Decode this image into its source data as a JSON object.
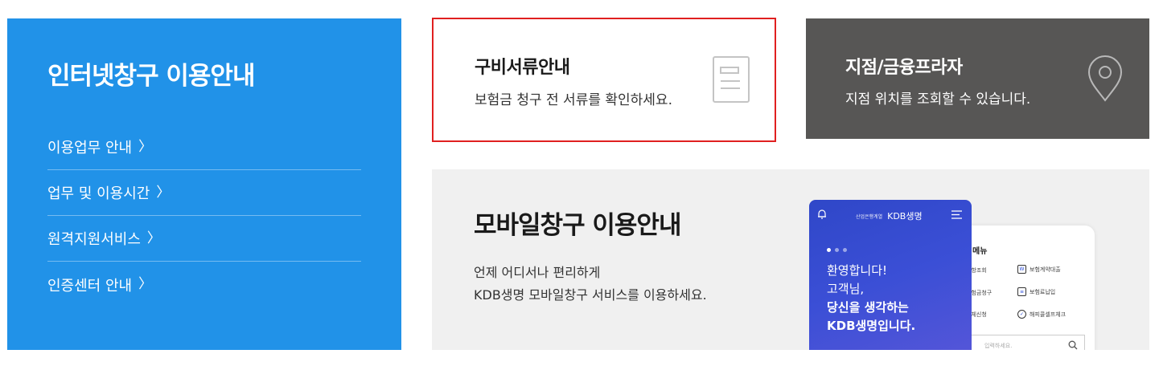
{
  "guide": {
    "title": "인터넷창구 이용안내",
    "menu": [
      {
        "label": "이용업무 안내"
      },
      {
        "label": "업무 및 이용시간"
      },
      {
        "label": "원격지원서비스"
      },
      {
        "label": "인증센터 안내"
      }
    ]
  },
  "docs": {
    "title": "구비서류안내",
    "desc": "보험금 청구 전 서류를 확인하세요.",
    "icon": "document-icon",
    "border_color": "#e02020"
  },
  "branch": {
    "title": "지점/금융프라자",
    "desc": "지점 위치를 조회할 수 있습니다.",
    "icon": "location-pin-icon",
    "bg_color": "#575655"
  },
  "mobile": {
    "title": "모바일창구 이용안내",
    "desc_line1": "언제 어디서나 편리하게",
    "desc_line2": "KDB생명 모바일창구 서비스를 이용하세요.",
    "phone_front": {
      "brand_small": "산업은행계열",
      "brand": "KDB생명",
      "line1": "환영합니다!",
      "line2": "고객님,",
      "line3": "당신을 생각하는",
      "line4": "KDB생명입니다."
    },
    "phone_back": {
      "menu_title": "메뉴",
      "items": [
        {
          "label": "사항조회"
        },
        {
          "label": "보험계약대출"
        },
        {
          "label": "보험금청구"
        },
        {
          "label": "보험료납입"
        },
        {
          "label": "이체신청"
        },
        {
          "label": "해피콜셀프체크"
        }
      ],
      "search_placeholder": "입력하세요."
    }
  },
  "colors": {
    "guide_bg": "#2192e8",
    "mobile_bg": "#f0f0f0"
  }
}
